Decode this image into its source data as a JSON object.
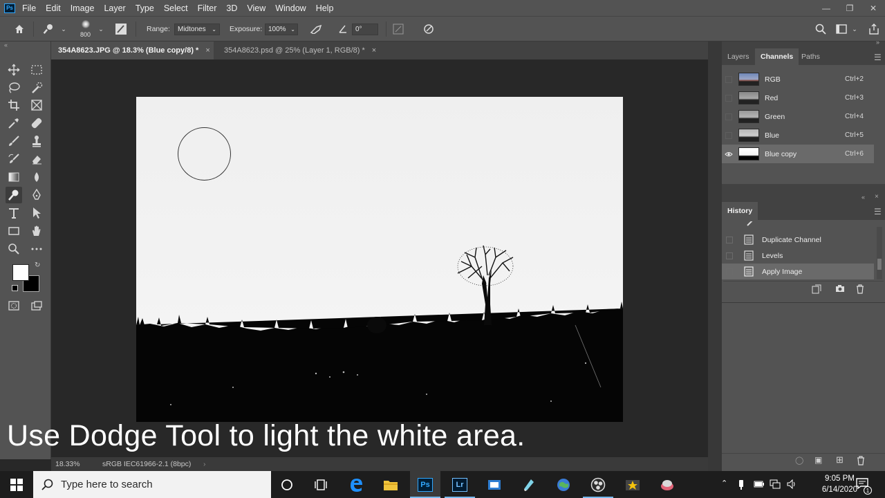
{
  "menu": {
    "logo": "Ps",
    "items": [
      "File",
      "Edit",
      "Image",
      "Layer",
      "Type",
      "Select",
      "Filter",
      "3D",
      "View",
      "Window",
      "Help"
    ]
  },
  "options": {
    "brush_size": "800",
    "range_label": "Range:",
    "range_value": "Midtones",
    "exposure_label": "Exposure:",
    "exposure_value": "100%",
    "angle_value": "0°"
  },
  "tabs": [
    {
      "label": "354A8623.JPG @ 18.3% (Blue copy/8) *",
      "active": true
    },
    {
      "label": "354A8623.psd @ 25% (Layer 1, RGB/8) *",
      "active": false
    }
  ],
  "status": {
    "zoom": "18.33%",
    "profile": "sRGB IEC61966-2.1 (8bpc)"
  },
  "caption": "Use Dodge Tool to light the white area.",
  "channels_panel": {
    "tabs": [
      "Layers",
      "Channels",
      "Paths"
    ],
    "active_tab": "Channels",
    "channels": [
      {
        "name": "RGB",
        "shortcut": "Ctrl+2"
      },
      {
        "name": "Red",
        "shortcut": "Ctrl+3"
      },
      {
        "name": "Green",
        "shortcut": "Ctrl+4"
      },
      {
        "name": "Blue",
        "shortcut": "Ctrl+5"
      },
      {
        "name": "Blue copy",
        "shortcut": "Ctrl+6",
        "selected": true,
        "visible": true
      }
    ]
  },
  "history_panel": {
    "title": "History",
    "items": [
      {
        "label": "Duplicate Channel"
      },
      {
        "label": "Levels"
      },
      {
        "label": "Apply Image",
        "selected": true
      }
    ]
  },
  "taskbar": {
    "search_placeholder": "Type here to search",
    "time": "9:05 PM",
    "date": "6/14/2020",
    "notification_count": "1",
    "apps": [
      "cortana-icon",
      "task-view-icon",
      "edge-icon",
      "file-explorer-icon",
      "photoshop-icon",
      "lightroom-icon",
      "app-icon-7",
      "app-icon-8",
      "app-icon-9",
      "obs-icon",
      "app-icon-11",
      "app-icon-12"
    ]
  },
  "colors": {
    "ui_dark": "#535353",
    "canvas_bg": "#282828",
    "selected_row": "#6a6a6a",
    "ps_blue": "#31a8ff"
  }
}
